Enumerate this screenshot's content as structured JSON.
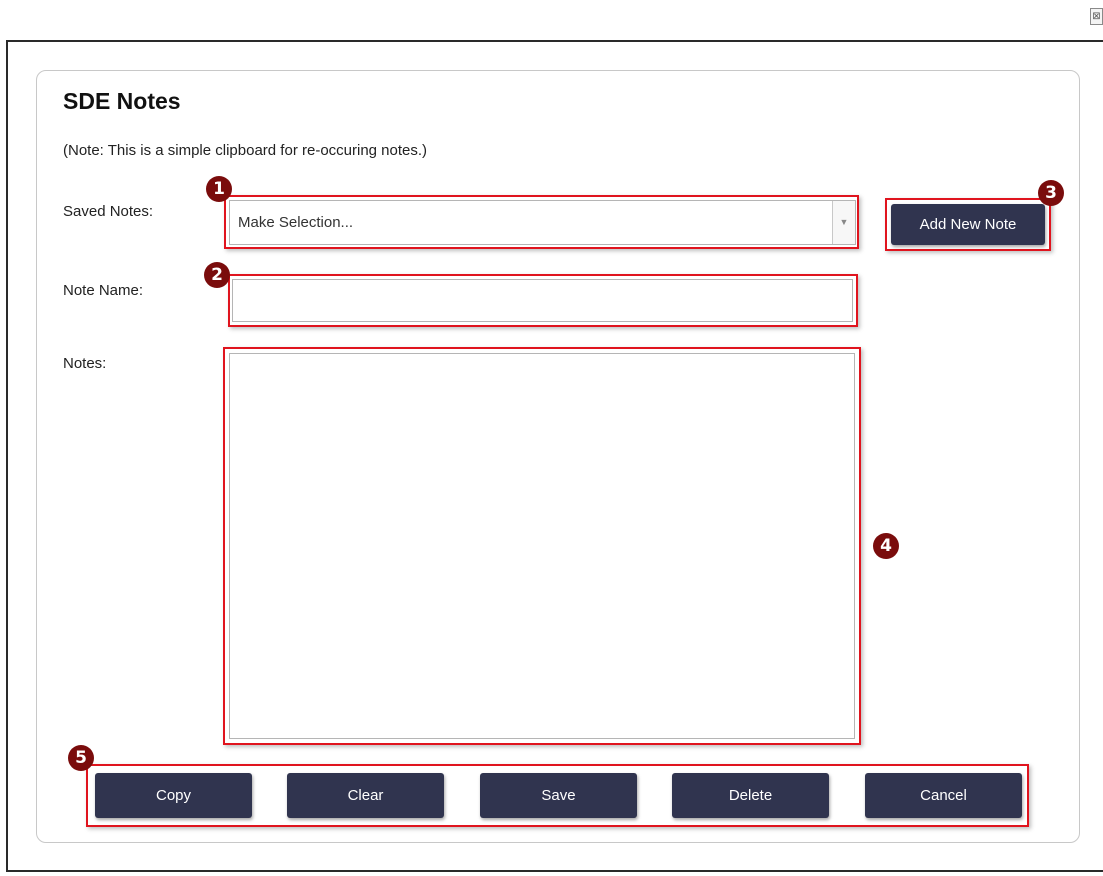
{
  "window": {
    "close_glyph": "⊠"
  },
  "header": {
    "title": "SDE Notes",
    "subtitle": "(Note: This is a simple clipboard for re-occuring notes.)"
  },
  "form": {
    "saved_notes": {
      "label": "Saved Notes:",
      "value": "Make Selection...",
      "options": [
        "Make Selection..."
      ]
    },
    "note_name": {
      "label": "Note Name:",
      "value": "",
      "placeholder": ""
    },
    "notes": {
      "label": "Notes:",
      "value": ""
    },
    "add_new_note_label": "Add New Note"
  },
  "actions": {
    "copy": "Copy",
    "clear": "Clear",
    "save": "Save",
    "delete": "Delete",
    "cancel": "Cancel"
  },
  "callouts": [
    "1",
    "2",
    "3",
    "4",
    "5"
  ],
  "colors": {
    "button_bg": "#30344f",
    "highlight": "#e0141e",
    "badge": "#7a0c0c"
  },
  "icons": {
    "close": "close-icon",
    "dropdown": "chevron-down-icon"
  }
}
